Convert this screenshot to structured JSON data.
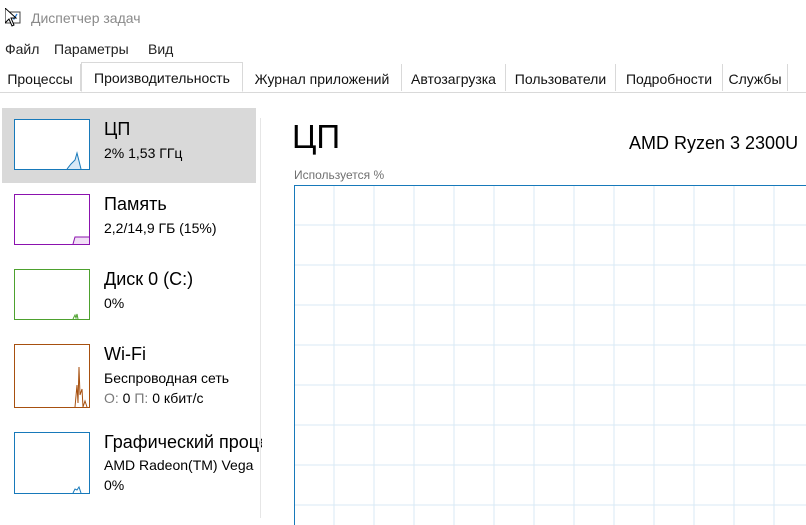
{
  "window": {
    "title": "Диспетчер задач",
    "app_icon": "task-manager-icon"
  },
  "menu": [
    "Файл",
    "Параметры",
    "Вид"
  ],
  "tabs": [
    {
      "label": "Процессы"
    },
    {
      "label": "Производительность",
      "active": true
    },
    {
      "label": "Журнал приложений"
    },
    {
      "label": "Автозагрузка"
    },
    {
      "label": "Пользователи"
    },
    {
      "label": "Подробности"
    },
    {
      "label": "Службы"
    }
  ],
  "sidebar": {
    "items": [
      {
        "name": "ЦП",
        "sub1": "2% 1,53 ГГц",
        "color": "#1779ba",
        "selected": true
      },
      {
        "name": "Память",
        "sub1": "2,2/14,9 ГБ (15%)",
        "color": "#8b12ae"
      },
      {
        "name": "Диск 0 (C:)",
        "sub1": "0%",
        "color": "#4da12e"
      },
      {
        "name": "Wi-Fi",
        "sub1": "Беспроводная сеть",
        "sub2_label_send": "О:",
        "sub2_send": "0",
        "sub2_label_recv": "П:",
        "sub2_recv": "0 кбит/с",
        "color": "#a7500f"
      },
      {
        "name": "Графический процессор",
        "sub1": "AMD Radeon(TM) Vega",
        "sub2": "0%",
        "color": "#1779ba"
      }
    ]
  },
  "main": {
    "title": "ЦП",
    "model": "AMD Ryzen 3 2300U",
    "graph_label": "Используется %",
    "graph_border_color": "#1779ba",
    "grid_color": "#d9eaf6"
  }
}
